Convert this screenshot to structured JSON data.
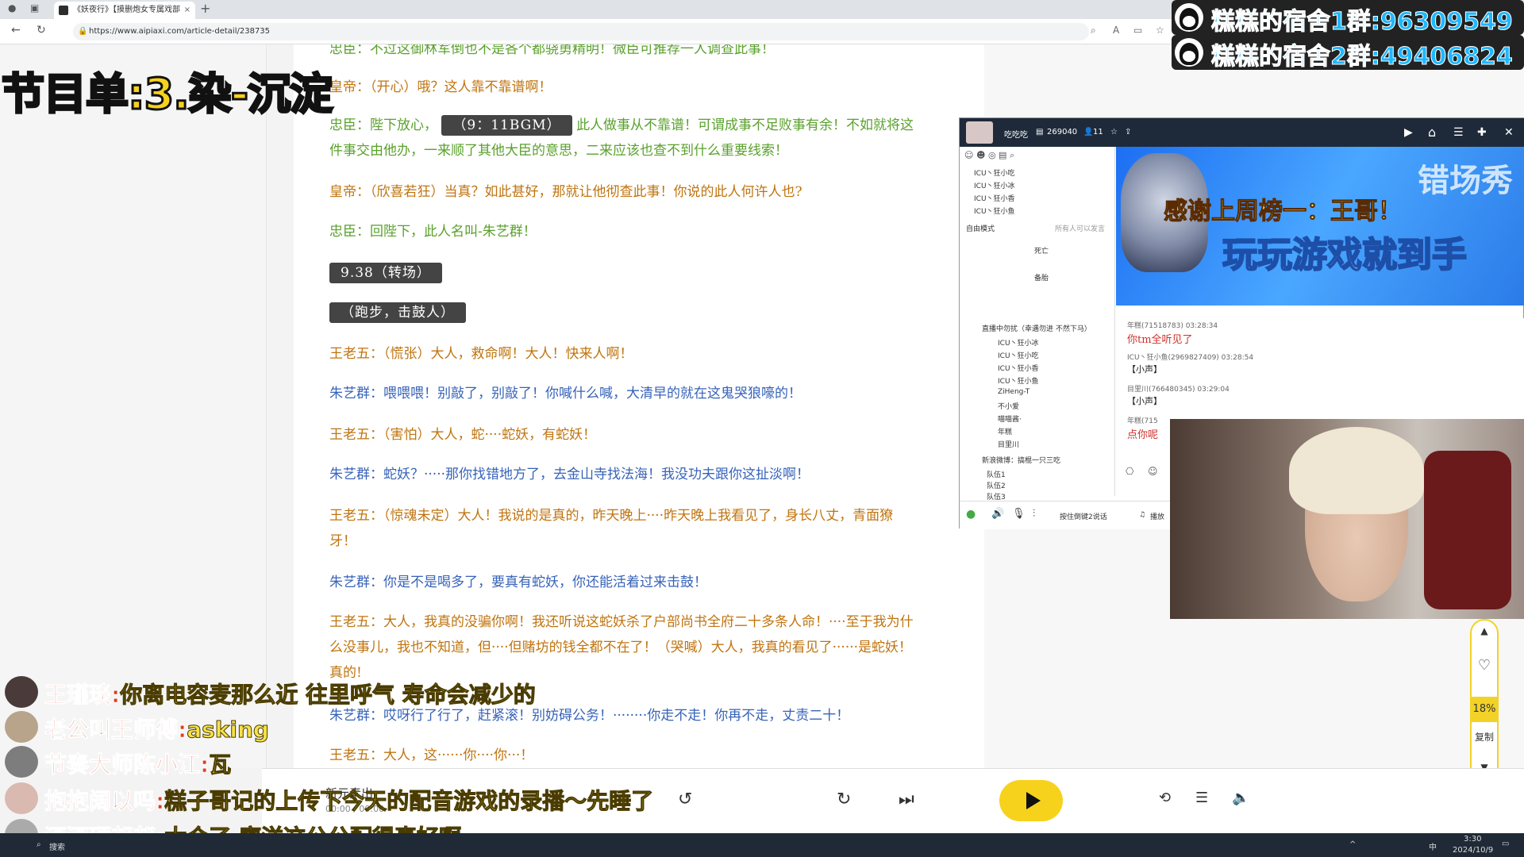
{
  "browser": {
    "tab_title": "《妖夜行》【摸删炮女专属戏部",
    "tab_close": "×",
    "new_tab": "+",
    "url": "https://www.aipiaxi.com/article-detail/238735"
  },
  "overlay": {
    "program_title": "节目单:3.染-沉淀",
    "qq_group_1": "糕糕的宿舍1群:96309549",
    "qq_group_2": "糕糕的宿舍2群:49406824"
  },
  "article": {
    "lines": [
      {
        "text": "忠臣：不过这御林军倒也不是各个都骁勇精明！微臣可推荐一人调查此事！"
      },
      {
        "text": "皇帝：（开心）哦？这人靠不靠谱啊！"
      },
      {
        "text_a": "忠臣：陛下放心，",
        "tag": "（9：11BGM）",
        "text_b": "此人做事从不靠谱！可谓成事不足败事有余！不如就将这件事交由他办，一来顺了其他大臣的意思，二来应该也查不到什么重要线索！"
      },
      {
        "text": "皇帝：（欣喜若狂）当真？如此甚好，那就让他彻查此事！你说的此人何许人也?"
      },
      {
        "text": "忠臣：回陛下，此人名叫-朱艺群！"
      },
      {
        "tag": "9.38（转场）"
      },
      {
        "tag": "（跑步，击鼓人）"
      },
      {
        "text": "王老五：（慌张）大人，救命啊！大人！快来人啊！"
      },
      {
        "text": "朱艺群：喂喂喂！别敲了，别敲了！你喊什么喊，大清早的就在这鬼哭狼嚎的！"
      },
      {
        "text": "王老五：（害怕）大人，蛇····蛇妖，有蛇妖！"
      },
      {
        "text": "朱艺群：蛇妖？·····那你找错地方了，去金山寺找法海！我没功夫跟你这扯淡啊！"
      },
      {
        "text": "王老五：（惊魂未定）大人！我说的是真的，昨天晚上····昨天晚上我看见了，身长八丈，青面獠牙！"
      },
      {
        "text": "朱艺群：你是不是喝多了，要真有蛇妖，你还能活着过来击鼓！"
      },
      {
        "text": "王老五：大人，我真的没骗你啊！我还听说这蛇妖杀了户部尚书全府二十多条人命！····至于我为什么没事儿，我也不知道，但····但赌坊的钱全都不在了！（哭喊）大人，我真的看见了······是蛇妖！真的!"
      },
      {
        "text": "朱艺群：哎呀行了行了，赶紧滚！别妨碍公务！········你走不走！你再不走，丈责二十！"
      },
      {
        "text": "王老五：大人，这······你····你···！"
      }
    ]
  },
  "stream": {
    "room_name": "吃吃吃",
    "room_id": "269040",
    "viewers": "11",
    "channel_list": [
      "ICU丶狂小吃",
      "ICU丶狂小冰",
      "ICU丶狂小香",
      "ICU丶狂小鱼"
    ],
    "mode": "自由模式",
    "speak_hint": "所有人可以发言",
    "seat_labels": [
      "死亡",
      "备胎"
    ],
    "group_title": "直播中勿扰（幸遇勿进 不然下马）",
    "members": [
      "ICU丶狂小冰",
      "ICU丶狂小吃",
      "ICU丶狂小香",
      "ICU丶狂小鱼",
      "ZiHeng-T",
      "不小爱",
      "喵喵酱·",
      "年糕",
      "目里川"
    ],
    "group2": "新浪微博：搞棍一只三吃",
    "teams": [
      "队伍1",
      "队伍2",
      "队伍3"
    ],
    "banner_text_1": "感谢上周榜一：王哥！",
    "banner_text_2": "玩玩游戏就到手",
    "banner_text_3": "错场秀",
    "chat": [
      {
        "meta": "年糕(71518783) 03:28:34",
        "msg": "你tm全听见了"
      },
      {
        "meta": "ICU丶狂小鱼(2969827409) 03:28:54",
        "msg": "【小声】"
      },
      {
        "meta": "目里川(766480345) 03:29:04",
        "msg": "【小声】"
      },
      {
        "meta": "年糕(715",
        "msg": "点你呢"
      }
    ],
    "bottom_hint": "按住倒键2说话",
    "bottom_play": "播放"
  },
  "side_control": {
    "percent": "18%",
    "copy": "复制"
  },
  "player": {
    "title": "新元素出",
    "time": "00:00 / 00:00"
  },
  "danmaku": [
    {
      "name": "王瑾琰:",
      "msg": "你离电容麦那么近 往里呼气 寿命会减少的"
    },
    {
      "name": "老公叫王师傅:",
      "msg": "asking"
    },
    {
      "name": "节奏大师陈小江:",
      "msg": "瓦"
    },
    {
      "name": "抱抱阔以吗:",
      "msg": "糕子哥记的上传下今天的配音游戏的录播～先睡了"
    },
    {
      "name": "酒酒硬邦邦:",
      "msg": "太合了 廖洋这公公配得真好啊"
    }
  ],
  "taskbar": {
    "search": "搜索",
    "time": "3:30",
    "date": "2024/10/9",
    "ime": "中"
  }
}
